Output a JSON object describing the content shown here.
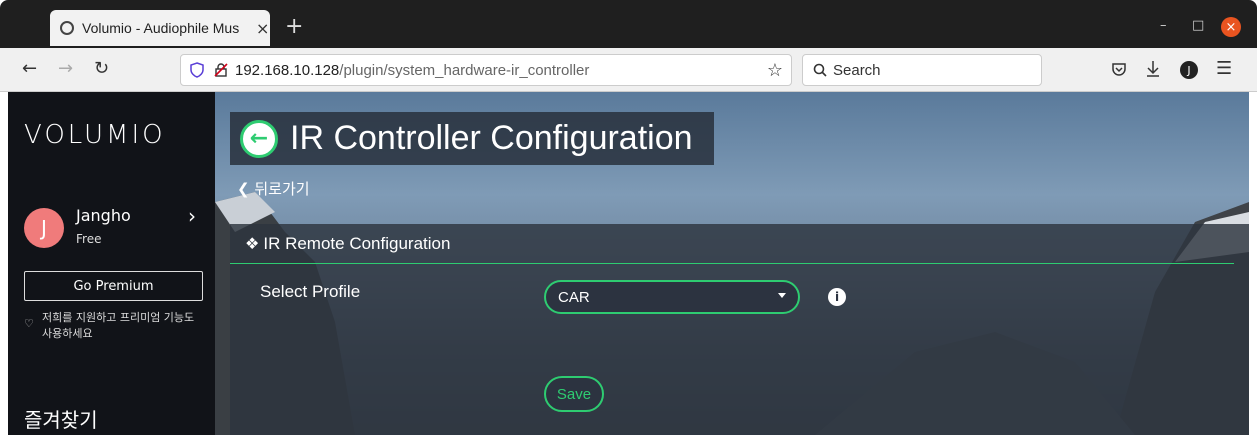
{
  "browser": {
    "tab_title": "Volumio - Audiophile Mus",
    "tab_close": "×",
    "new_tab": "+",
    "url_host": "192.168.10.128",
    "url_path": "/plugin/system_hardware-ir_controller",
    "search_placeholder": "Search",
    "account_initial": "J",
    "window_controls": [
      "–",
      "□",
      "×"
    ]
  },
  "sidebar": {
    "logo": "VOLUMIO",
    "user": {
      "initial": "J",
      "name": "Jangho",
      "plan": "Free"
    },
    "premium_button": "Go Premium",
    "support_text": "저희를 지원하고 프리미엄 기능도 사용하세요",
    "favorites": "즐겨찾기"
  },
  "main": {
    "title": "IR Controller Configuration",
    "back_link": "뒤로가기",
    "panel": {
      "title": "IR Remote Configuration",
      "select_label": "Select Profile",
      "select_value": "CAR",
      "save_button": "Save"
    }
  },
  "colors": {
    "accent": "#2ecc71",
    "sidebar_bg": "#111318",
    "avatar": "#f07b7b",
    "browser_close": "#e95420"
  }
}
